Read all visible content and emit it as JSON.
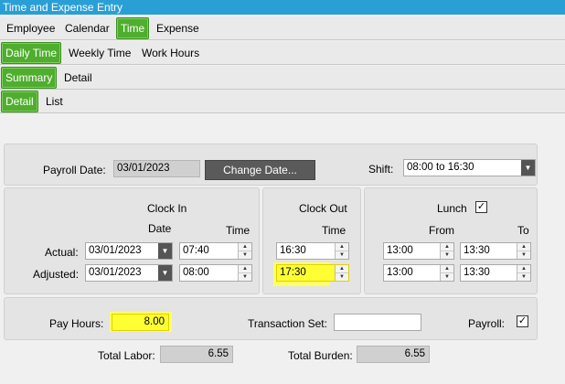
{
  "window": {
    "title": "Time and Expense Entry"
  },
  "tabs_main": [
    "Employee",
    "Calendar",
    "Time",
    "Expense"
  ],
  "tabs_time": [
    "Daily Time",
    "Weekly Time",
    "Work Hours"
  ],
  "tabs_daily": [
    "Summary",
    "Detail"
  ],
  "tabs_summary": [
    "Detail",
    "List"
  ],
  "header": {
    "payroll_date_label": "Payroll Date:",
    "payroll_date_value": "03/01/2023",
    "change_date_button": "Change Date...",
    "shift_label": "Shift:",
    "shift_value": "08:00 to 16:30"
  },
  "clock_in": {
    "title": "Clock In",
    "date_header": "Date",
    "time_header": "Time",
    "actual_date": "03/01/2023",
    "actual_time": "07:40",
    "adjusted_date": "03/01/2023",
    "adjusted_time": "08:00"
  },
  "clock_out": {
    "title": "Clock Out",
    "time_header": "Time",
    "actual_time": "16:30",
    "adjusted_time": "17:30"
  },
  "lunch": {
    "title": "Lunch",
    "checked": true,
    "from_header": "From",
    "to_header": "To",
    "actual_from": "13:00",
    "actual_to": "13:30",
    "adjusted_from": "13:00",
    "adjusted_to": "13:30"
  },
  "rows": {
    "actual_label": "Actual:",
    "adjusted_label": "Adjusted:"
  },
  "footer": {
    "pay_hours_label": "Pay Hours:",
    "pay_hours_value": "8.00",
    "transaction_set_label": "Transaction Set:",
    "transaction_set_value": "",
    "payroll_label": "Payroll:",
    "payroll_checked": true,
    "total_labor_label": "Total Labor:",
    "total_labor_value": "6.55",
    "total_burden_label": "Total Burden:",
    "total_burden_value": "6.55"
  },
  "colors": {
    "titlebar": "#2a9fd6",
    "active_tab": "#4fae2d",
    "highlight": "#ffff33"
  }
}
